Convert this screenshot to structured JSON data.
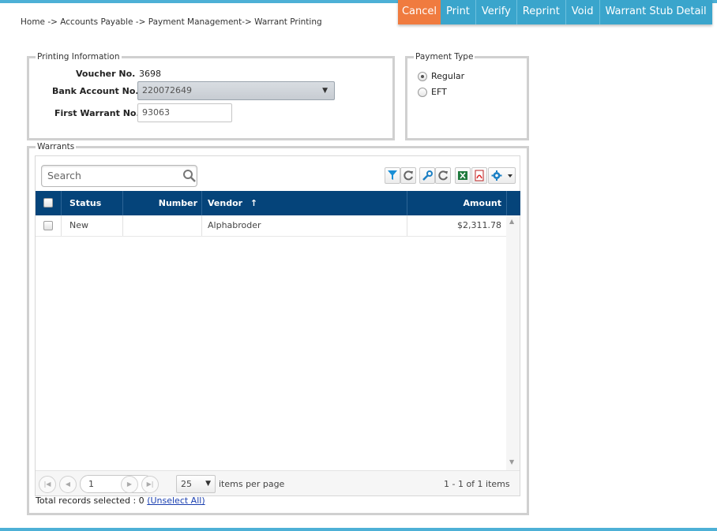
{
  "breadcrumb": "Home -> Accounts Payable -> Payment Management-> Warrant Printing",
  "actions": {
    "cancel": "Cancel",
    "print": "Print",
    "verify": "Verify",
    "reprint": "Reprint",
    "void": "Void",
    "stub_detail": "Warrant Stub Detail"
  },
  "printing_info": {
    "legend": "Printing Information",
    "voucher_label": "Voucher No.",
    "voucher_value": "3698",
    "bank_label": "Bank Account No.",
    "bank_value": "220072649",
    "first_warrant_label": "First Warrant No.",
    "first_warrant_value": "93063"
  },
  "payment_type": {
    "legend": "Payment Type",
    "options": [
      "Regular",
      "EFT"
    ],
    "selected": "Regular"
  },
  "warrants": {
    "legend": "Warrants",
    "search_placeholder": "Search",
    "columns": [
      "Status",
      "Number",
      "Vendor",
      "Amount"
    ],
    "sort": {
      "column": "Vendor",
      "direction": "ascending"
    },
    "rows": [
      {
        "status": "New",
        "number": "",
        "vendor": "Alphabroder",
        "amount": "$2,311.78"
      }
    ],
    "toolbar_icons": [
      "filter-icon",
      "refresh-filter-icon",
      "wrench-icon",
      "refresh-layout-icon",
      "excel-icon",
      "pdf-icon",
      "settings-icon"
    ]
  },
  "pager": {
    "page": "1",
    "page_size": "25",
    "items_per_page_label": "items per page",
    "summary": "1 - 1 of 1 items"
  },
  "selection": {
    "text": "Total records selected : 0",
    "unselect_label": "(Unselect All)"
  },
  "colors": {
    "accent": "#3aa5cc",
    "cancel": "#f07b3f",
    "grid_header": "#05447a"
  }
}
